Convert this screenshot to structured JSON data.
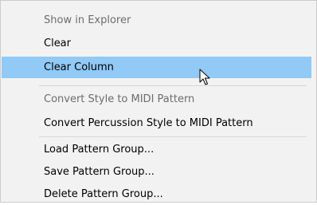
{
  "context_menu": {
    "items": [
      {
        "label": "Show in Explorer",
        "enabled": false
      },
      {
        "label": "Clear",
        "enabled": true
      },
      {
        "label": "Clear Column",
        "enabled": true,
        "highlighted": true
      },
      {
        "label": "Convert Style to MIDI Pattern",
        "enabled": false
      },
      {
        "label": "Convert Percussion Style to MIDI Pattern",
        "enabled": true
      },
      {
        "label": "Load Pattern Group...",
        "enabled": true
      },
      {
        "label": "Save Pattern Group...",
        "enabled": true
      },
      {
        "label": "Delete Pattern Group...",
        "enabled": true
      }
    ],
    "highlight_color": "#91c9f7",
    "disabled_text_color": "#6d6d6d",
    "background_color": "#f2f2f2"
  },
  "cursor": {
    "icon": "arrow-pointer-icon"
  }
}
